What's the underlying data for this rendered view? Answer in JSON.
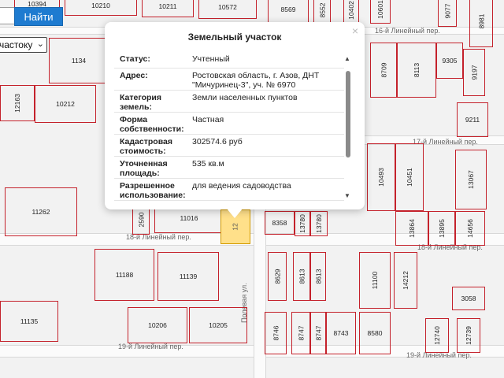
{
  "toolbar": {
    "search_value": "",
    "find_label": "Найти",
    "type_select_value": "частоку"
  },
  "popup": {
    "title": "Земельный участок",
    "close_glyph": "×",
    "rows": [
      {
        "key": "Статус",
        "value": "Учтенный"
      },
      {
        "key": "Адрес",
        "value": "Ростовская область, г. Азов, ДНТ \"Мичуринец-3\", уч. № 6970"
      },
      {
        "key": "Категория земель",
        "value": "Земли населенных пунктов"
      },
      {
        "key": "Форма собственности",
        "value": "Частная"
      },
      {
        "key": "Кадастровая стоимость",
        "value": "302574.6 руб"
      },
      {
        "key": "Уточненная площадь",
        "value": "535 кв.м"
      },
      {
        "key": "Разрешенное использование",
        "value": "для ведения садоводства"
      }
    ],
    "scroll_up": "▲",
    "scroll_down": "▼"
  },
  "map": {
    "streets": {
      "s17": "17-й Линейный пер.",
      "s18a": "18-й Линейный пер.",
      "s18b": "18-й Линейный пер.",
      "s19a": "19-й Линейный пер.",
      "s19b": "19-й Линейный пер.",
      "s_top": "16-й Линейный пер.",
      "polevaya": "Полевая ул."
    },
    "parcels": {
      "p10394": "10394",
      "p10210": "10210",
      "p10211": "10211",
      "p10572": "10572",
      "p8569": "8569",
      "p8552": "8552",
      "p10402": "10402",
      "p10601": "10601",
      "p9077": "9077",
      "p8981": "8981",
      "p1134": "1134",
      "p12163": "12163",
      "p10212": "10212",
      "p8709": "8709",
      "p8113": "8113",
      "p9305": "9305",
      "p9197": "9197",
      "p9211": "9211",
      "p10493": "10493",
      "p10451": "10451",
      "p13067": "13067",
      "p11262": "11262",
      "p2590": "2590",
      "p11016": "11016",
      "p12sel": "12",
      "p8358": "8358",
      "p13780a": "13780",
      "p13780b": "13780",
      "p13864": "13864",
      "p13895": "13895",
      "p14656": "14656",
      "p11188": "11188",
      "p11139": "11139",
      "p11135": "11135",
      "p10206": "10206",
      "p10205": "10205",
      "p8629": "8629",
      "p8613a": "8613",
      "p8613b": "8613",
      "p11100": "11100",
      "p14212": "14212",
      "p3058": "3058",
      "p8746": "8746",
      "p8747a": "8747",
      "p8747b": "8747",
      "p8743": "8743",
      "p8580": "8580",
      "p12740": "12740",
      "p12739": "12739"
    }
  }
}
